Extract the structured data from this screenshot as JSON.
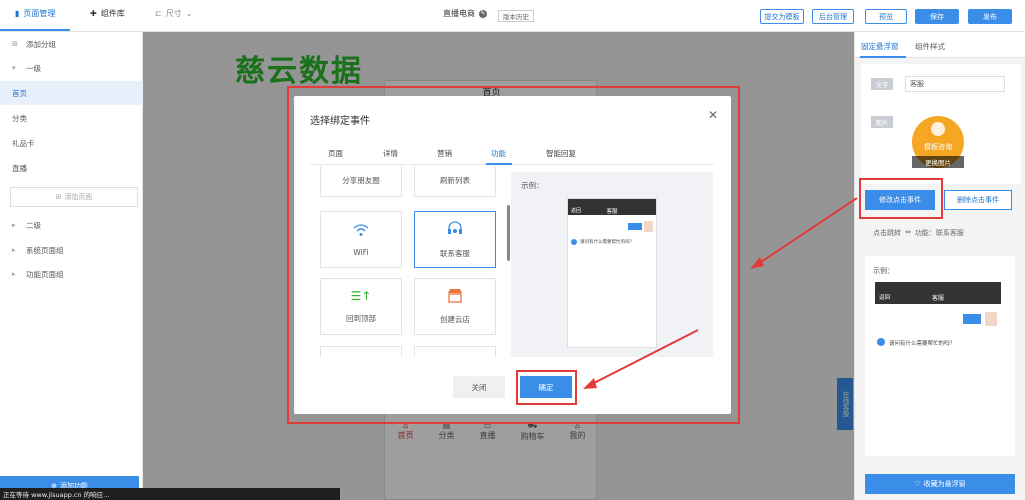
{
  "topbar": {
    "tabs": [
      "页面管理",
      "组件库"
    ],
    "size_label": "尺寸",
    "page_title": "直播电商",
    "version_tag": "版本历史",
    "buttons": [
      "提交为模板",
      "后台管理",
      "预览",
      "保存",
      "发布"
    ]
  },
  "left": {
    "add_group": "添加分组",
    "group1": "一级",
    "pages": [
      "首页",
      "分类",
      "礼品卡",
      "直播"
    ],
    "add_page": "添加页面",
    "groups": [
      "二级",
      "系统页面组",
      "功能页面组"
    ],
    "add_function": "添加功能"
  },
  "watermark": "慈云数据",
  "phone": {
    "title": "首页",
    "nav": [
      "首页",
      "分类",
      "直播",
      "购物车",
      "我的"
    ],
    "float_service": "在线客服"
  },
  "right": {
    "tabs": [
      "固定悬浮窗",
      "组件样式"
    ],
    "text_label": "文字",
    "text_value": "客服",
    "image_label": "图片",
    "avatar_caption": "模板咨询",
    "change_image": "更换图片",
    "modify_event": "修改点击事件",
    "delete_event": "删除点击事件",
    "jump_label": "点击跳转",
    "jump_value": "功能：联系客服",
    "example_label": "示例：",
    "preview_header": "客服",
    "preview_question": "请问有什么需要帮忙的吗？",
    "preview_back": "返回",
    "collect_button": "收藏为悬浮窗"
  },
  "dialog": {
    "title": "选择绑定事件",
    "close": "✕",
    "tabs": [
      "页面",
      "详情",
      "营销",
      "功能",
      "智能回复"
    ],
    "active_tab": "功能",
    "cards": [
      {
        "label": "分享朋友圈",
        "icon": "share-icon"
      },
      {
        "label": "刷新列表",
        "icon": "refresh-icon"
      },
      {
        "label": "WiFi",
        "icon": "wifi-icon"
      },
      {
        "label": "联系客服",
        "icon": "headset-icon"
      },
      {
        "label": "回到顶部",
        "icon": "back-to-top-icon"
      },
      {
        "label": "创建云店",
        "icon": "store-icon"
      }
    ],
    "example_label": "示例：",
    "preview_header": "客服",
    "preview_back": "返回",
    "preview_question": "请问有什么需要帮忙的吗？",
    "cancel": "关闭",
    "confirm": "确定"
  },
  "statusbar": "正在等待 www.jisuapp.cn 的响应...",
  "colors": {
    "accent": "#3b8ee8",
    "annotation": "#e23b3b",
    "watermark": "#2db52d"
  }
}
